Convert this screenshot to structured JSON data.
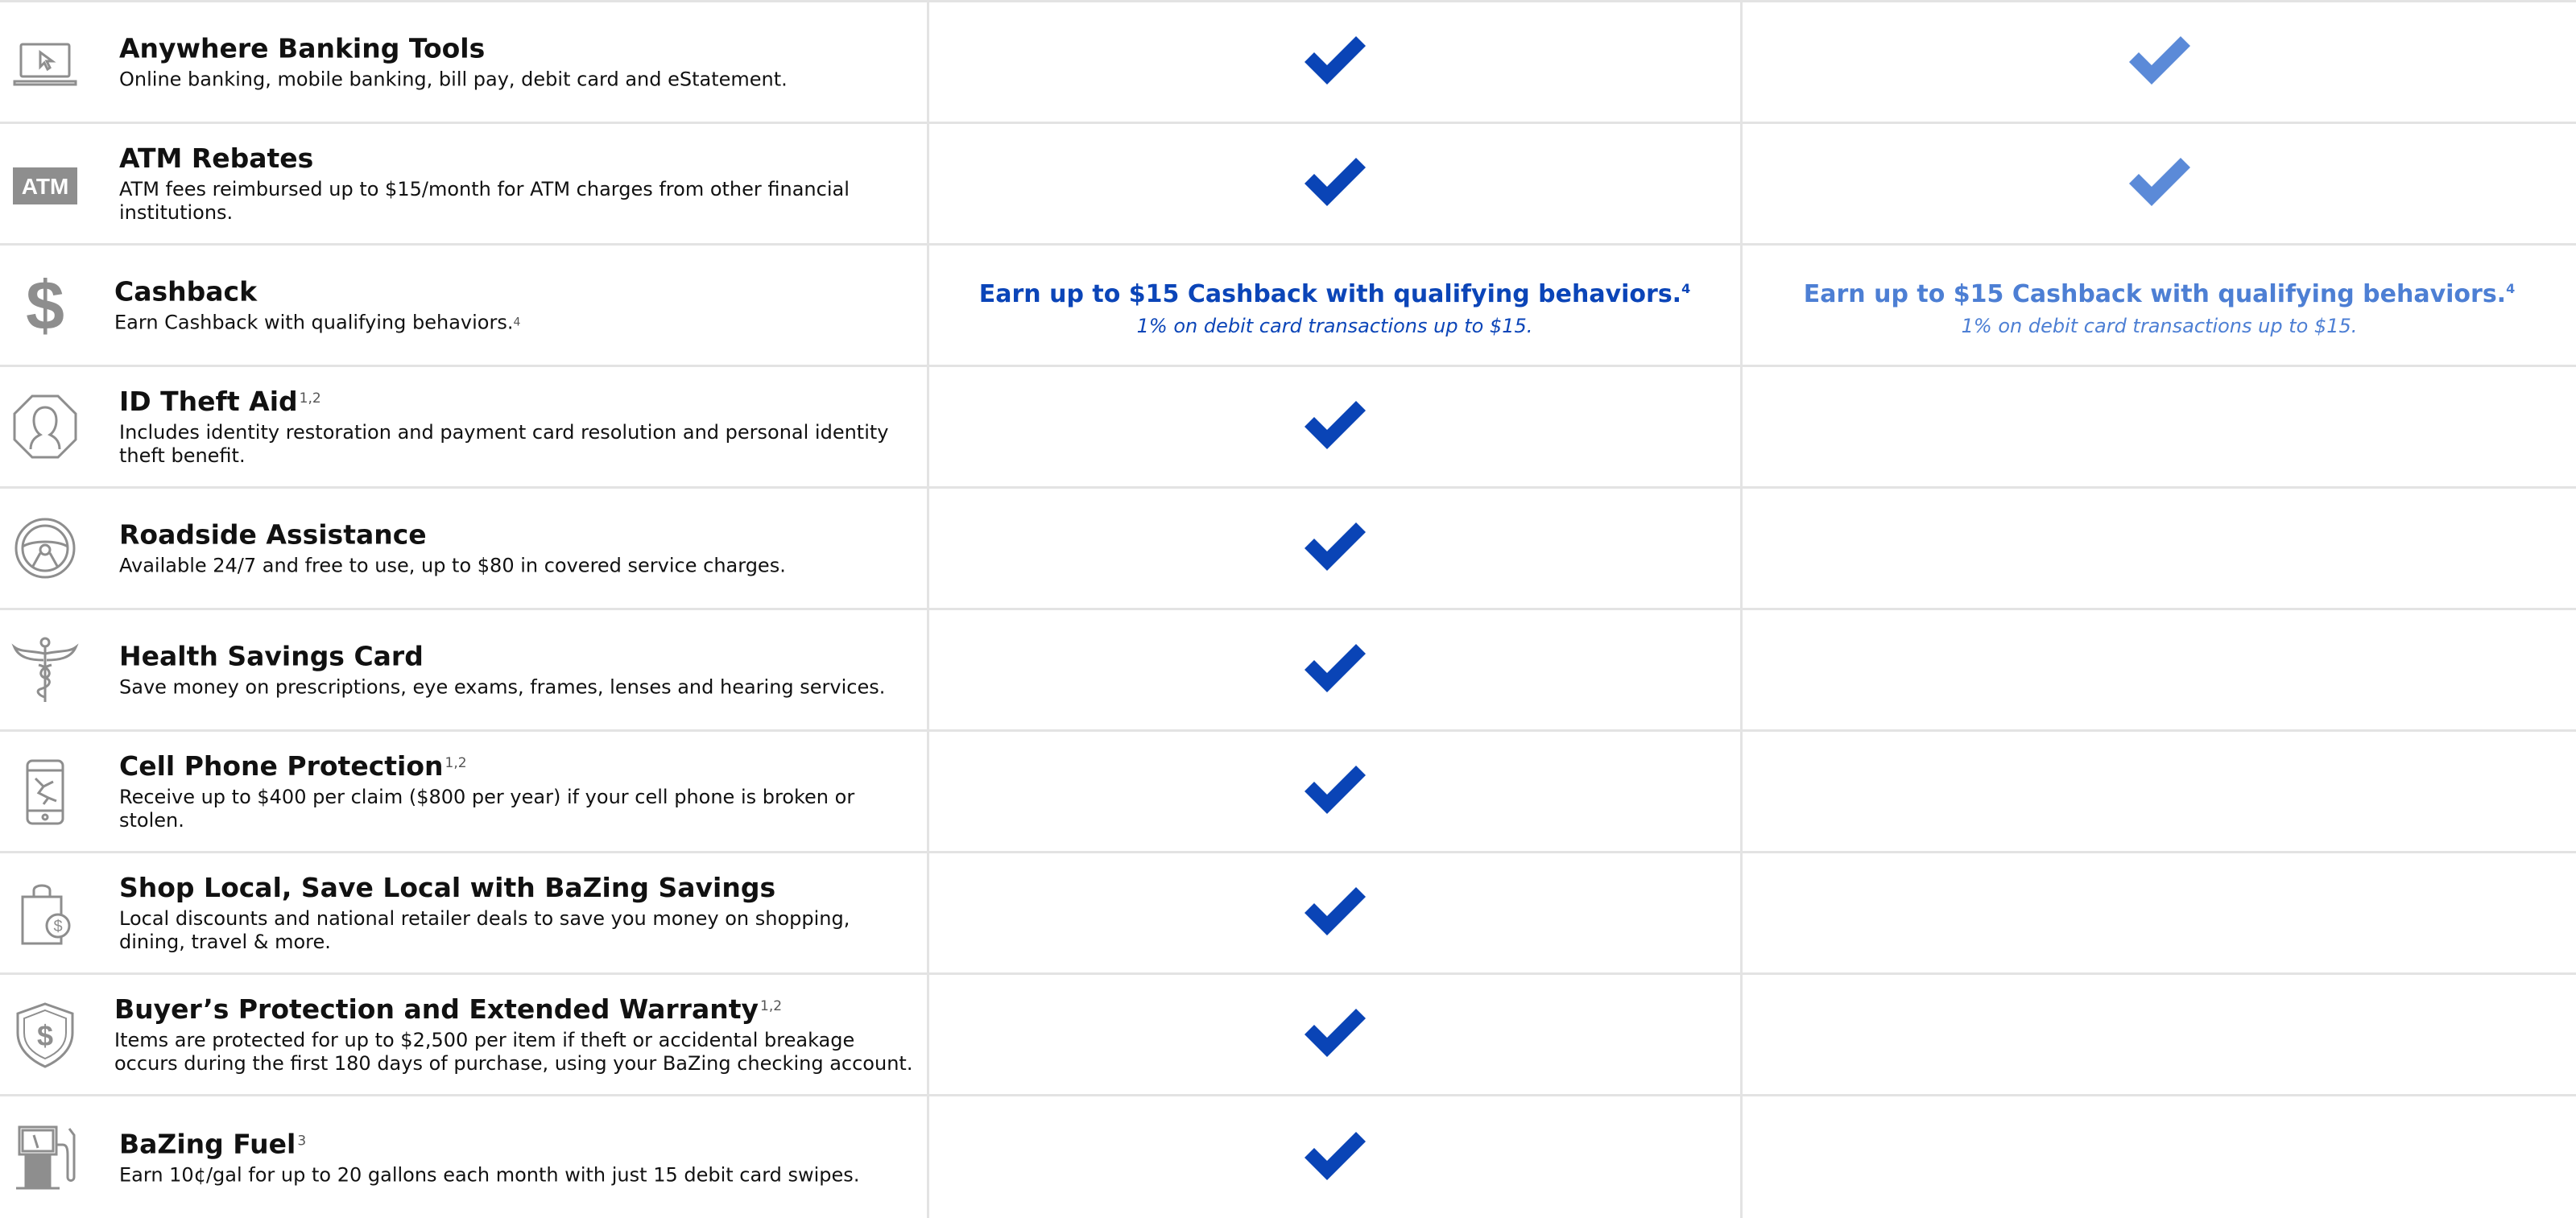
{
  "colors": {
    "check_primary": "#0a44b6",
    "check_secondary": "#5b8ad8",
    "offer_primary": "#0b45b8",
    "offer_secondary": "#4d7fd4",
    "icon_gray": "#8e8e8e"
  },
  "rows": [
    {
      "icon": "laptop-cursor-icon",
      "title": "Anywhere Banking Tools",
      "sup": "",
      "desc": "Online banking, mobile banking, bill pay, debit card and eStatement.",
      "col1": "check",
      "col2": "check"
    },
    {
      "icon": "atm-badge-icon",
      "icon_text": "ATM",
      "title": "ATM Rebates",
      "sup": "",
      "desc": "ATM fees reimbursed up to $15/month for ATM charges from other financial institutions.",
      "col1": "check",
      "col2": "check"
    },
    {
      "icon": "dollar-sign-icon",
      "title": "Cashback",
      "sup": "",
      "desc": "Earn Cashback with qualifying behaviors.",
      "desc_sup": "4",
      "col1": "offer",
      "col2": "offer"
    },
    {
      "icon": "identity-octagon-icon",
      "title": "ID Theft Aid",
      "sup": "1,2",
      "desc_line1": "Includes identity restoration and payment card resolution and personal identity",
      "desc_line2": "theft benefit.",
      "col1": "check",
      "col2": ""
    },
    {
      "icon": "steering-wheel-icon",
      "title": "Roadside Assistance",
      "sup": "",
      "desc": "Available 24/7 and free to use, up to $80 in covered service charges.",
      "col1": "check",
      "col2": ""
    },
    {
      "icon": "caduceus-icon",
      "title": "Health Savings Card",
      "sup": "",
      "desc": "Save money on prescriptions, eye exams, frames, lenses and hearing services.",
      "col1": "check",
      "col2": ""
    },
    {
      "icon": "cracked-phone-icon",
      "title": "Cell Phone Protection",
      "sup": "1,2",
      "desc": "Receive up to $400 per claim ($800 per year) if your cell phone is broken or stolen.",
      "col1": "check",
      "col2": ""
    },
    {
      "icon": "shopping-bag-icon",
      "title": "Shop Local, Save Local with BaZing Savings",
      "sup": "",
      "desc_line1": "Local discounts and national retailer deals to save you money on shopping,",
      "desc_line2": "dining, travel & more.",
      "col1": "check",
      "col2": ""
    },
    {
      "icon": "shield-dollar-icon",
      "title": "Buyer’s Protection and Extended Warranty",
      "sup": "1,2",
      "desc_line1": "Items are protected for up to $2,500 per item if theft or accidental breakage",
      "desc_line2": "occurs during the first 180 days of purchase, using your BaZing checking account.",
      "col1": "check",
      "col2": ""
    },
    {
      "icon": "fuel-pump-icon",
      "title": "BaZing Fuel",
      "sup": "3",
      "desc": "Earn 10¢/gal for up to 20 gallons each month with just 15 debit card swipes.",
      "col1": "check",
      "col2": ""
    }
  ],
  "cashback_offer": {
    "title": "Earn up to $15 Cashback with qualifying behaviors.",
    "title_sup": "4",
    "sub": "1% on debit card transactions up to $15."
  }
}
